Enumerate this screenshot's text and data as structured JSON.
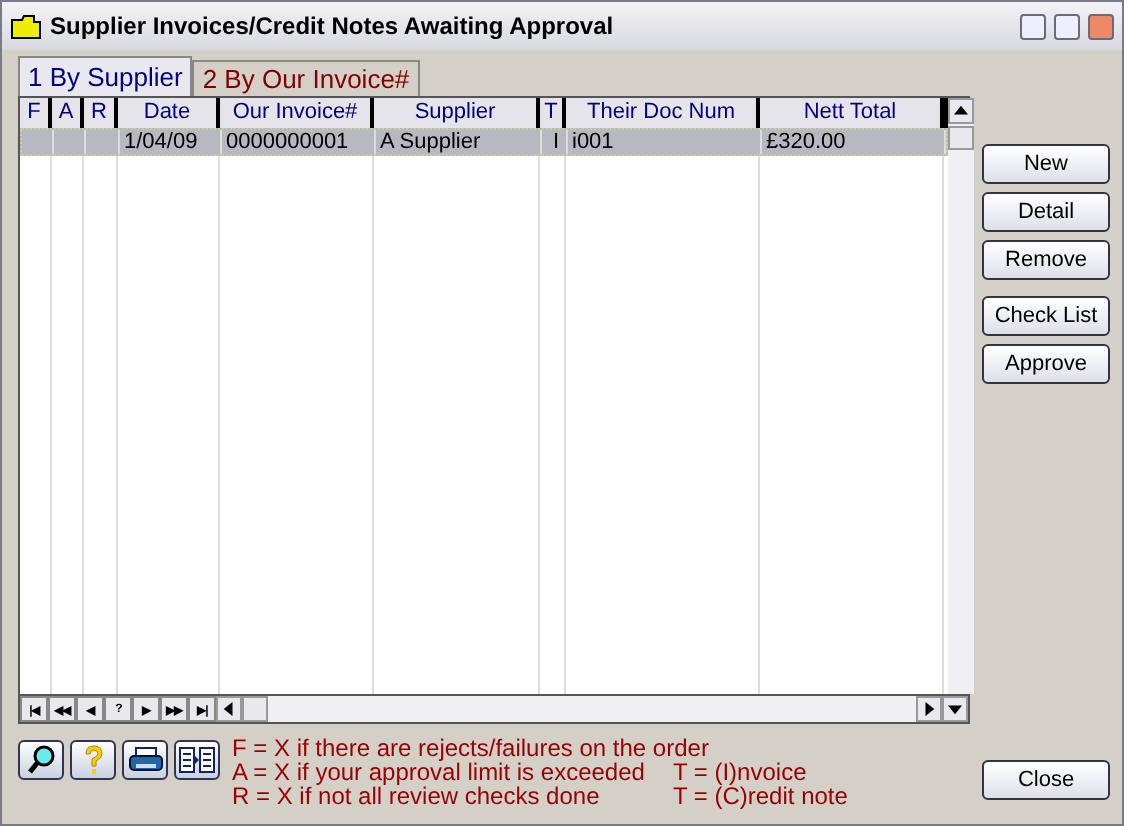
{
  "window": {
    "title": "Supplier Invoices/Credit Notes Awaiting Approval"
  },
  "tabs": [
    {
      "label": "1 By Supplier",
      "selected": true
    },
    {
      "label": "2 By Our Invoice#",
      "selected": false
    }
  ],
  "table": {
    "columns": [
      "F",
      "A",
      "R",
      "Date",
      "Our Invoice#",
      "Supplier",
      "T",
      "Their Doc Num",
      "Nett Total"
    ],
    "rows": [
      {
        "selected": true,
        "cells": [
          "",
          "",
          "",
          "1/04/09",
          "0000000001",
          "A Supplier",
          "I",
          "i001",
          "£320.00"
        ]
      }
    ]
  },
  "navigator": [
    "|◀",
    "◀◀",
    "◀",
    "?",
    "▶",
    "▶▶",
    "▶|"
  ],
  "side_buttons": [
    "New",
    "Detail",
    "Remove",
    "Check List",
    "Approve"
  ],
  "tool_buttons": [
    {
      "kind": "search"
    },
    {
      "kind": "help"
    },
    {
      "kind": "print"
    },
    {
      "kind": "columns"
    }
  ],
  "legend": [
    "F = X if there are rejects/failures on the order",
    "A = X if your approval limit is exceeded",
    "R = X if not all review checks done"
  ],
  "type_legend": [
    "T = (I)nvoice",
    "T = (C)redit note"
  ],
  "close_button": "Close"
}
